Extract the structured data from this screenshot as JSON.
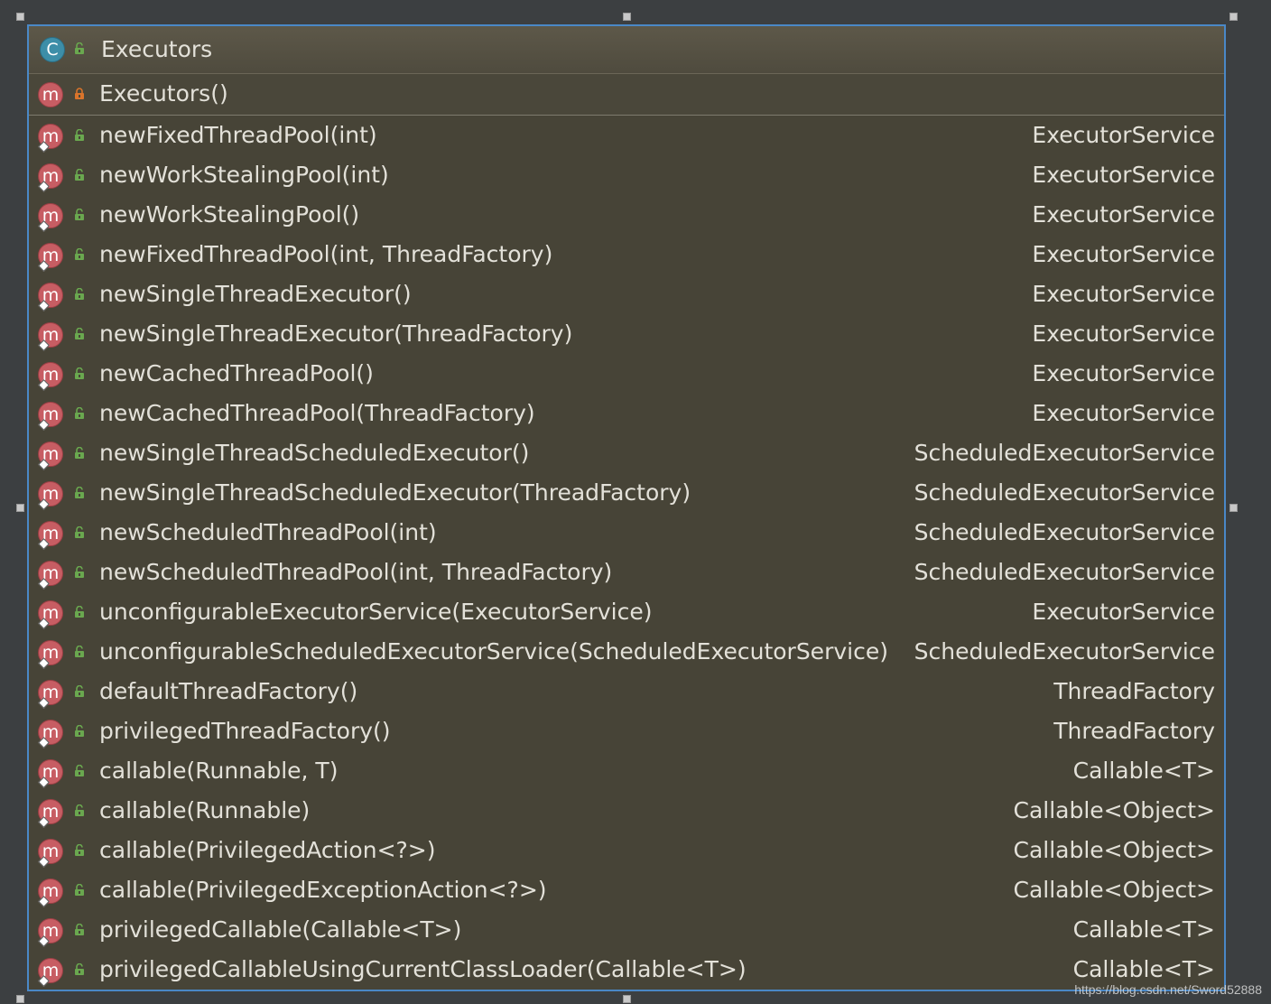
{
  "class_header": {
    "type_icon_letter": "C",
    "title": "Executors",
    "access": "public"
  },
  "constructor": {
    "icon_letter": "m",
    "label": "Executors()",
    "access": "private"
  },
  "methods": [
    {
      "name": "newFixedThreadPool(int)",
      "returns": "ExecutorService"
    },
    {
      "name": "newWorkStealingPool(int)",
      "returns": "ExecutorService"
    },
    {
      "name": "newWorkStealingPool()",
      "returns": "ExecutorService"
    },
    {
      "name": "newFixedThreadPool(int, ThreadFactory)",
      "returns": "ExecutorService"
    },
    {
      "name": "newSingleThreadExecutor()",
      "returns": "ExecutorService"
    },
    {
      "name": "newSingleThreadExecutor(ThreadFactory)",
      "returns": "ExecutorService"
    },
    {
      "name": "newCachedThreadPool()",
      "returns": "ExecutorService"
    },
    {
      "name": "newCachedThreadPool(ThreadFactory)",
      "returns": "ExecutorService"
    },
    {
      "name": "newSingleThreadScheduledExecutor()",
      "returns": "ScheduledExecutorService"
    },
    {
      "name": "newSingleThreadScheduledExecutor(ThreadFactory)",
      "returns": "ScheduledExecutorService"
    },
    {
      "name": "newScheduledThreadPool(int)",
      "returns": "ScheduledExecutorService"
    },
    {
      "name": "newScheduledThreadPool(int, ThreadFactory)",
      "returns": "ScheduledExecutorService"
    },
    {
      "name": "unconfigurableExecutorService(ExecutorService)",
      "returns": "ExecutorService"
    },
    {
      "name": "unconfigurableScheduledExecutorService(ScheduledExecutorService)",
      "returns": "ScheduledExecutorService"
    },
    {
      "name": "defaultThreadFactory()",
      "returns": "ThreadFactory"
    },
    {
      "name": "privilegedThreadFactory()",
      "returns": "ThreadFactory"
    },
    {
      "name": "callable(Runnable, T)",
      "returns": "Callable<T>"
    },
    {
      "name": "callable(Runnable)",
      "returns": "Callable<Object>"
    },
    {
      "name": "callable(PrivilegedAction<?>)",
      "returns": "Callable<Object>"
    },
    {
      "name": "callable(PrivilegedExceptionAction<?>)",
      "returns": "Callable<Object>"
    },
    {
      "name": "privilegedCallable(Callable<T>)",
      "returns": "Callable<T>"
    },
    {
      "name": "privilegedCallableUsingCurrentClassLoader(Callable<T>)",
      "returns": "Callable<T>"
    }
  ],
  "method_icon_letter": "m",
  "watermark": "https://blog.csdn.net/Sword52888",
  "colors": {
    "panel_bg": "#474437",
    "selection_border": "#4a88c7",
    "text": "#e3e1d9",
    "class_icon": "#3d8ea8",
    "method_icon": "#c75d63",
    "public_lock": "#6aa84f",
    "private_lock": "#d9742b"
  },
  "icons": {
    "public": "unlocked-padlock-icon",
    "private": "locked-padlock-icon",
    "static": "diamond-static-icon"
  }
}
